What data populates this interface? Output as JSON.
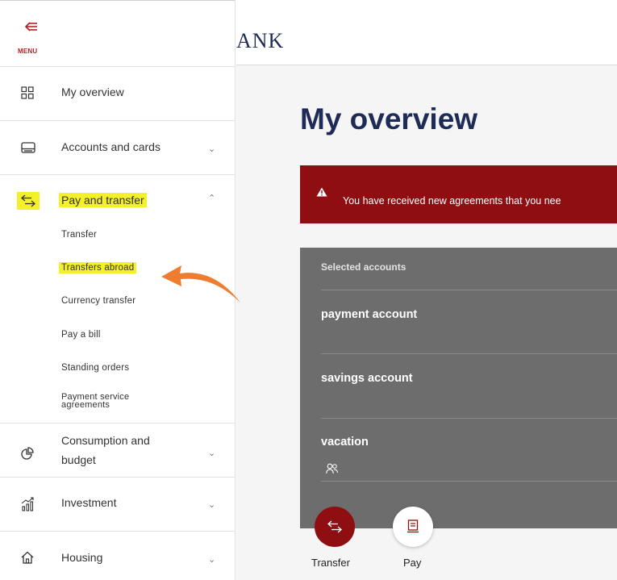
{
  "menu": {
    "label": "MENU"
  },
  "brand": {
    "logo_text": "ANK"
  },
  "sidebar": {
    "items": [
      {
        "label": "My overview",
        "icon": "grid-icon"
      },
      {
        "label": "Accounts and cards",
        "icon": "card-icon"
      },
      {
        "label": "Pay and transfer",
        "icon": "transfer-icon",
        "highlighted": true,
        "expanded": true
      },
      {
        "label": "Consumption and budget",
        "label_line1": "Consumption and",
        "label_line2": "budget",
        "icon": "pie-chart-icon"
      },
      {
        "label": "Investment",
        "icon": "investment-icon"
      },
      {
        "label": "Housing",
        "icon": "house-icon"
      }
    ],
    "subitems": [
      {
        "label": "Transfer"
      },
      {
        "label": "Transfers abroad",
        "highlighted": true
      },
      {
        "label": "Currency transfer"
      },
      {
        "label": "Pay a bill"
      },
      {
        "label": "Standing orders"
      },
      {
        "label": "Payment service agreements",
        "label_line1": "Payment service",
        "label_line2": "agreements"
      }
    ]
  },
  "main": {
    "title": "My overview",
    "alert": {
      "text": "You have received new agreements that you nee"
    },
    "accounts": {
      "header": "Selected accounts",
      "rows": [
        {
          "name": "payment account"
        },
        {
          "name": "savings account"
        },
        {
          "name": "vacation",
          "shared": true
        }
      ]
    },
    "actions": {
      "transfer_label": "Transfer",
      "pay_label": "Pay"
    }
  },
  "colors": {
    "brand_red": "#8e0e12",
    "navy": "#1d2b56",
    "highlight_yellow": "#f4f02a",
    "annotation_orange": "#ed7d31",
    "accounts_panel": "#6d6d6d"
  }
}
